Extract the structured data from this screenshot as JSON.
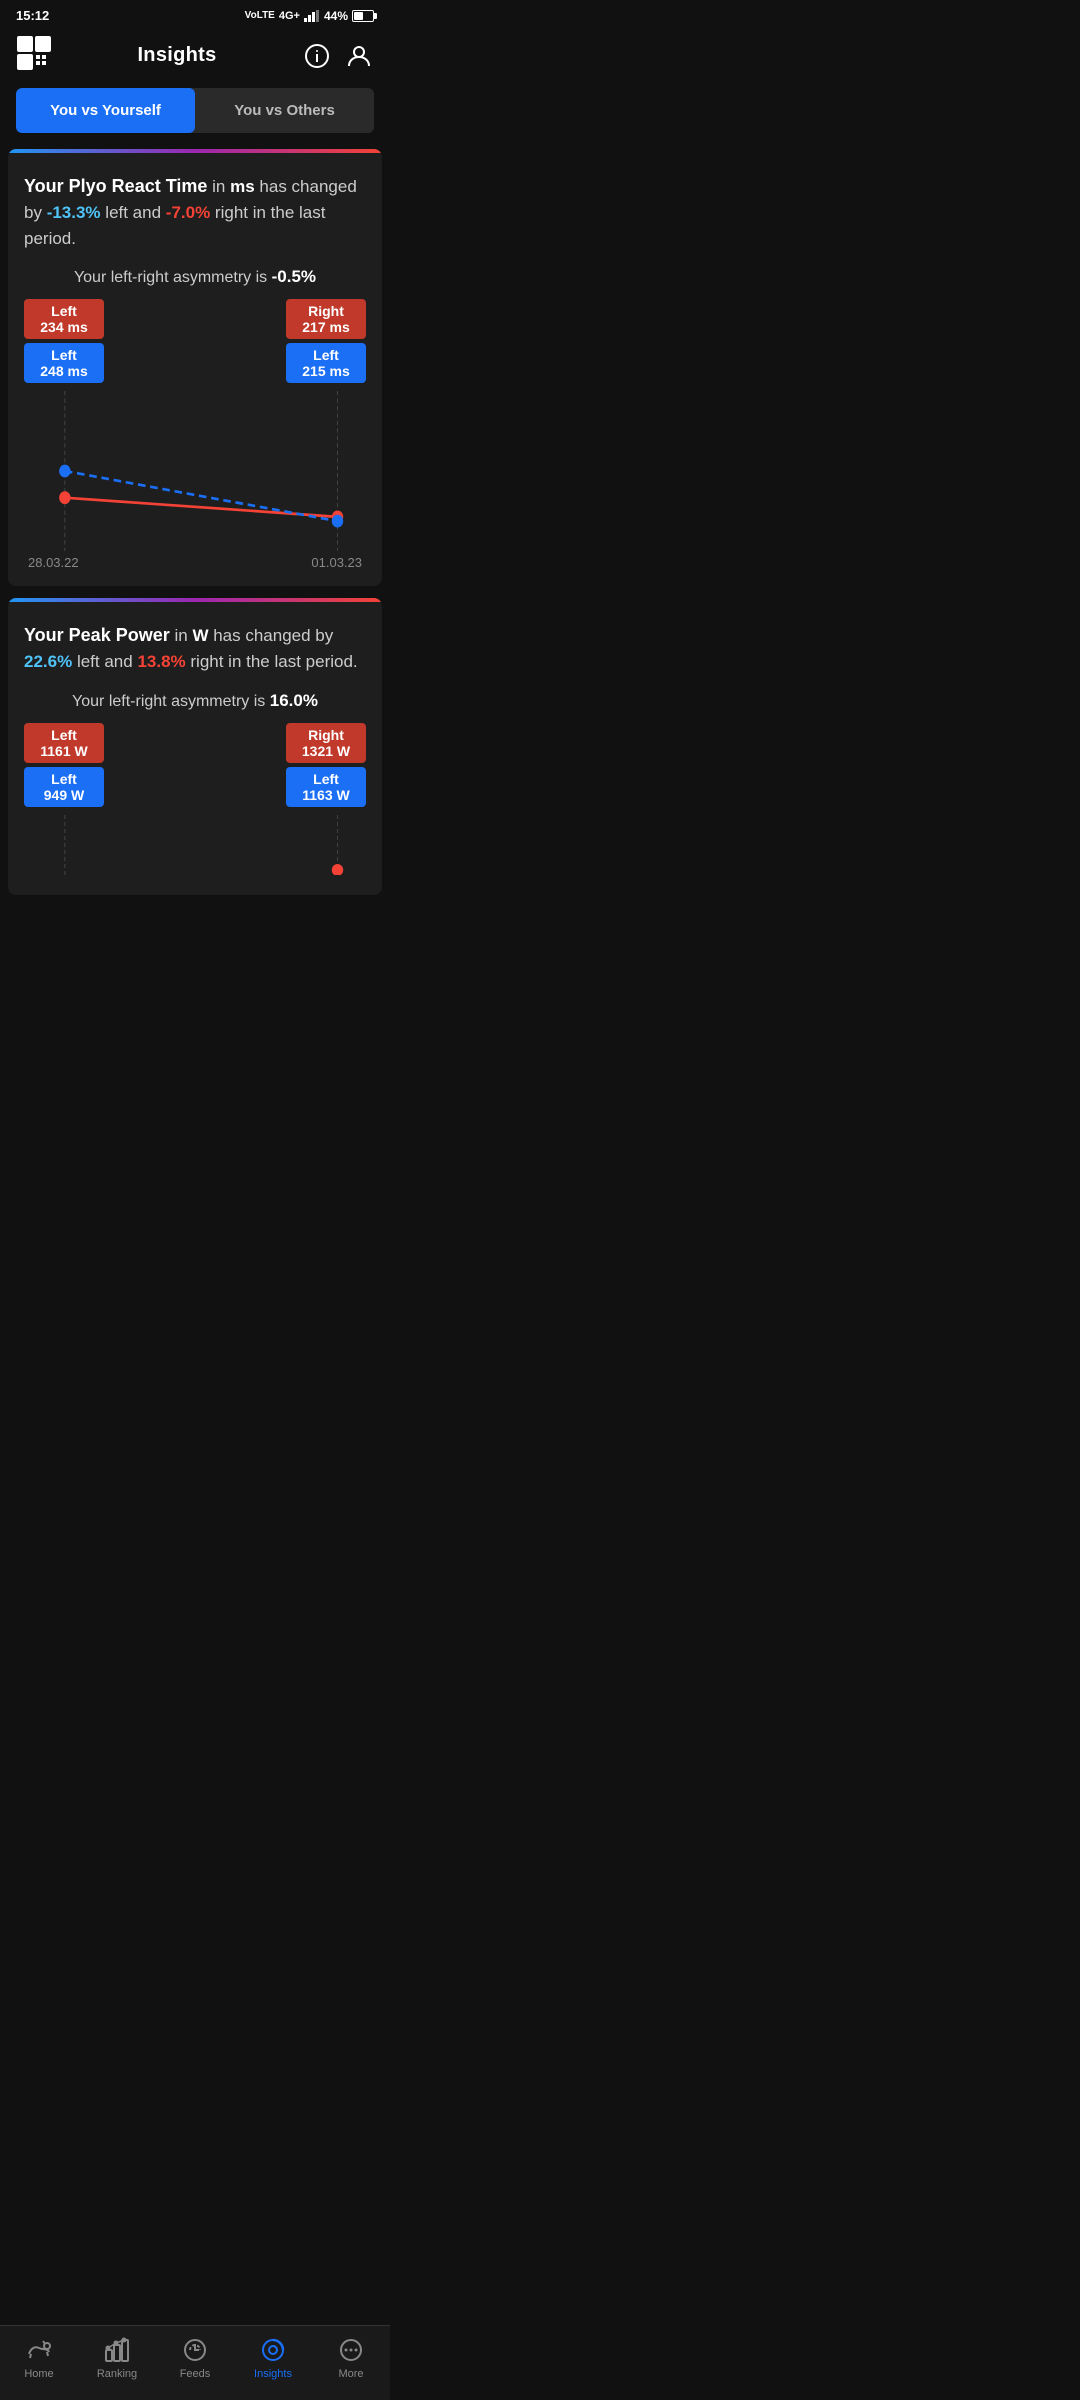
{
  "statusBar": {
    "time": "15:12",
    "carrier": "VoLTE 4G+",
    "signal": "4G+",
    "battery": "44%"
  },
  "header": {
    "title": "Insights"
  },
  "tabs": {
    "active": "you_vs_yourself",
    "items": [
      {
        "id": "you_vs_yourself",
        "label": "You vs Yourself"
      },
      {
        "id": "you_vs_others",
        "label": "You vs Others"
      }
    ]
  },
  "cards": [
    {
      "id": "plyo_react",
      "titleBold": "Your Plyo React Time",
      "unit": "ms",
      "titleMid": "has changed",
      "changeLine": "by",
      "leftChange": "-13.3%",
      "leftChangeColor": "blue",
      "midText": "left and",
      "rightChange": "-7.0%",
      "rightChangeColor": "red",
      "periodText": "right in the last period.",
      "asymmetryLabel": "Your left-right asymmetry is",
      "asymmetryValue": "-0.5%",
      "labelsLeft": [
        {
          "color": "red",
          "title": "Left",
          "value": "234 ms"
        },
        {
          "color": "blue",
          "title": "Left",
          "value": "248 ms"
        }
      ],
      "labelsRight": [
        {
          "color": "red",
          "title": "Right",
          "value": "217 ms"
        },
        {
          "color": "blue",
          "title": "Left",
          "value": "215 ms"
        }
      ],
      "dateStart": "28.03.22",
      "dateEnd": "01.03.23",
      "chart": {
        "line1": {
          "x1": 0.12,
          "y1": 0.42,
          "x2": 0.92,
          "y2": 0.78,
          "color": "#f44336",
          "dashed": false
        },
        "line2": {
          "x1": 0.12,
          "y1": 0.3,
          "x2": 0.92,
          "y2": 0.82,
          "color": "#1a6ff5",
          "dashed": true
        }
      }
    },
    {
      "id": "peak_power",
      "titleBold": "Your Peak Power",
      "unit": "W",
      "titleMid": "has changed by",
      "changeLine": "",
      "leftChange": "22.6%",
      "leftChangeColor": "blue",
      "midText": "left and",
      "rightChange": "13.8%",
      "rightChangeColor": "red",
      "periodText": "right in the last period.",
      "asymmetryLabel": "Your left-right asymmetry is",
      "asymmetryValue": "16.0%",
      "labelsLeft": [
        {
          "color": "red",
          "title": "Left",
          "value": "1161 W"
        },
        {
          "color": "blue",
          "title": "Left",
          "value": "949 W"
        }
      ],
      "labelsRight": [
        {
          "color": "red",
          "title": "Right",
          "value": "1321 W"
        },
        {
          "color": "blue",
          "title": "Left",
          "value": "1163 W"
        }
      ],
      "dateStart": "",
      "dateEnd": ""
    }
  ],
  "bottomNav": {
    "items": [
      {
        "id": "home",
        "label": "Home",
        "active": false
      },
      {
        "id": "ranking",
        "label": "Ranking",
        "active": false
      },
      {
        "id": "feeds",
        "label": "Feeds",
        "active": false
      },
      {
        "id": "insights",
        "label": "Insights",
        "active": true
      },
      {
        "id": "more",
        "label": "More",
        "active": false
      }
    ]
  }
}
